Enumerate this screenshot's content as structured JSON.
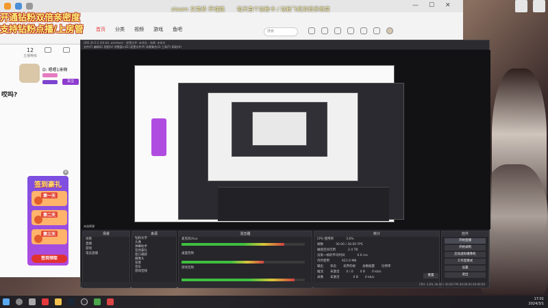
{
  "overlay": {
    "top_caption": [
      "steam 文鬼桥 开魂路",
      "每天首个钻粉卡 / 钻粉飞机双倍亲密度"
    ],
    "stream_title_line1": "开通钻粉双倍亲密度",
    "stream_title_line2": "支持钻粉点播/上房管"
  },
  "browser": {
    "nav": [
      "首页",
      "分类",
      "视频",
      "游戏",
      "鱼吧"
    ],
    "active_nav": 0,
    "search_placeholder": "搜索"
  },
  "streamer": {
    "stats": [
      {
        "value": "12",
        "label": "主播等级"
      }
    ],
    "name": "D: 嗯嗯1来啊",
    "follow": "关注",
    "question": "哎吗?"
  },
  "promo": {
    "title": "签到豪礼",
    "days": [
      "第一天",
      "第二天",
      "第三天"
    ],
    "claim": "签到领取"
  },
  "obs": {
    "title": "OBS 30.0.2 (64-bit, windows) - 配置文件: 未命名 - 场景: 未命名",
    "menu": "文件(F)  编辑(E)  视图(V)  停靠窗口(D)  配置文件(P)  场景集合(S)  工具(T)  帮助(H)",
    "no_source": "未选择源",
    "docks": {
      "scenes": "场景",
      "sources": "来源",
      "mixer": "混音器",
      "stats": "统计",
      "controls": "控件"
    },
    "scene_items": [
      "场景",
      "直播",
      "游戏",
      "电竞直播"
    ],
    "source_items": [
      "钻粉文字",
      "头像",
      "弹幕助手",
      "签到豪礼",
      "窗口捕获",
      "摄像头",
      "背景",
      "音乐",
      "游戏音频"
    ],
    "mixer_channels": [
      "麦克风/Aux",
      "桌面音频",
      "游戏音频"
    ],
    "stats_rows": [
      [
        "CPU 使用率",
        "3.6%"
      ],
      [
        "帧数",
        "30.00 / 30.00 FPS"
      ],
      [
        "磁盘空间可用",
        "2.4 TB"
      ],
      [
        "渲染一帧的平均时间",
        "0.6 ms"
      ],
      [
        "内存使用",
        "621.0 MB"
      ]
    ],
    "output_headers": [
      "输出",
      "状态",
      "丢弃的帧",
      "总数据量",
      "比特率"
    ],
    "output_rows": [
      [
        "推流",
        "未激活",
        "0 / 0",
        "0 B",
        "0 kb/s"
      ],
      [
        "录像",
        "未激活",
        "",
        "0 B",
        "0 kb/s"
      ]
    ],
    "controls": [
      "开始直播",
      "开始录制",
      "启动虚拟摄像机",
      "工作室模式",
      "设置",
      "退出"
    ],
    "reset": "重置",
    "status": "CPU: 3.6%  30.00 / 30.00 FPS  00:00:00  00:00:00"
  },
  "taskbar": {
    "time": "17:01",
    "date": "2024/3/1"
  },
  "colors": {
    "brand": "#e4393c",
    "follow": "#8e3bcf",
    "promo": "#7b4fe0"
  }
}
